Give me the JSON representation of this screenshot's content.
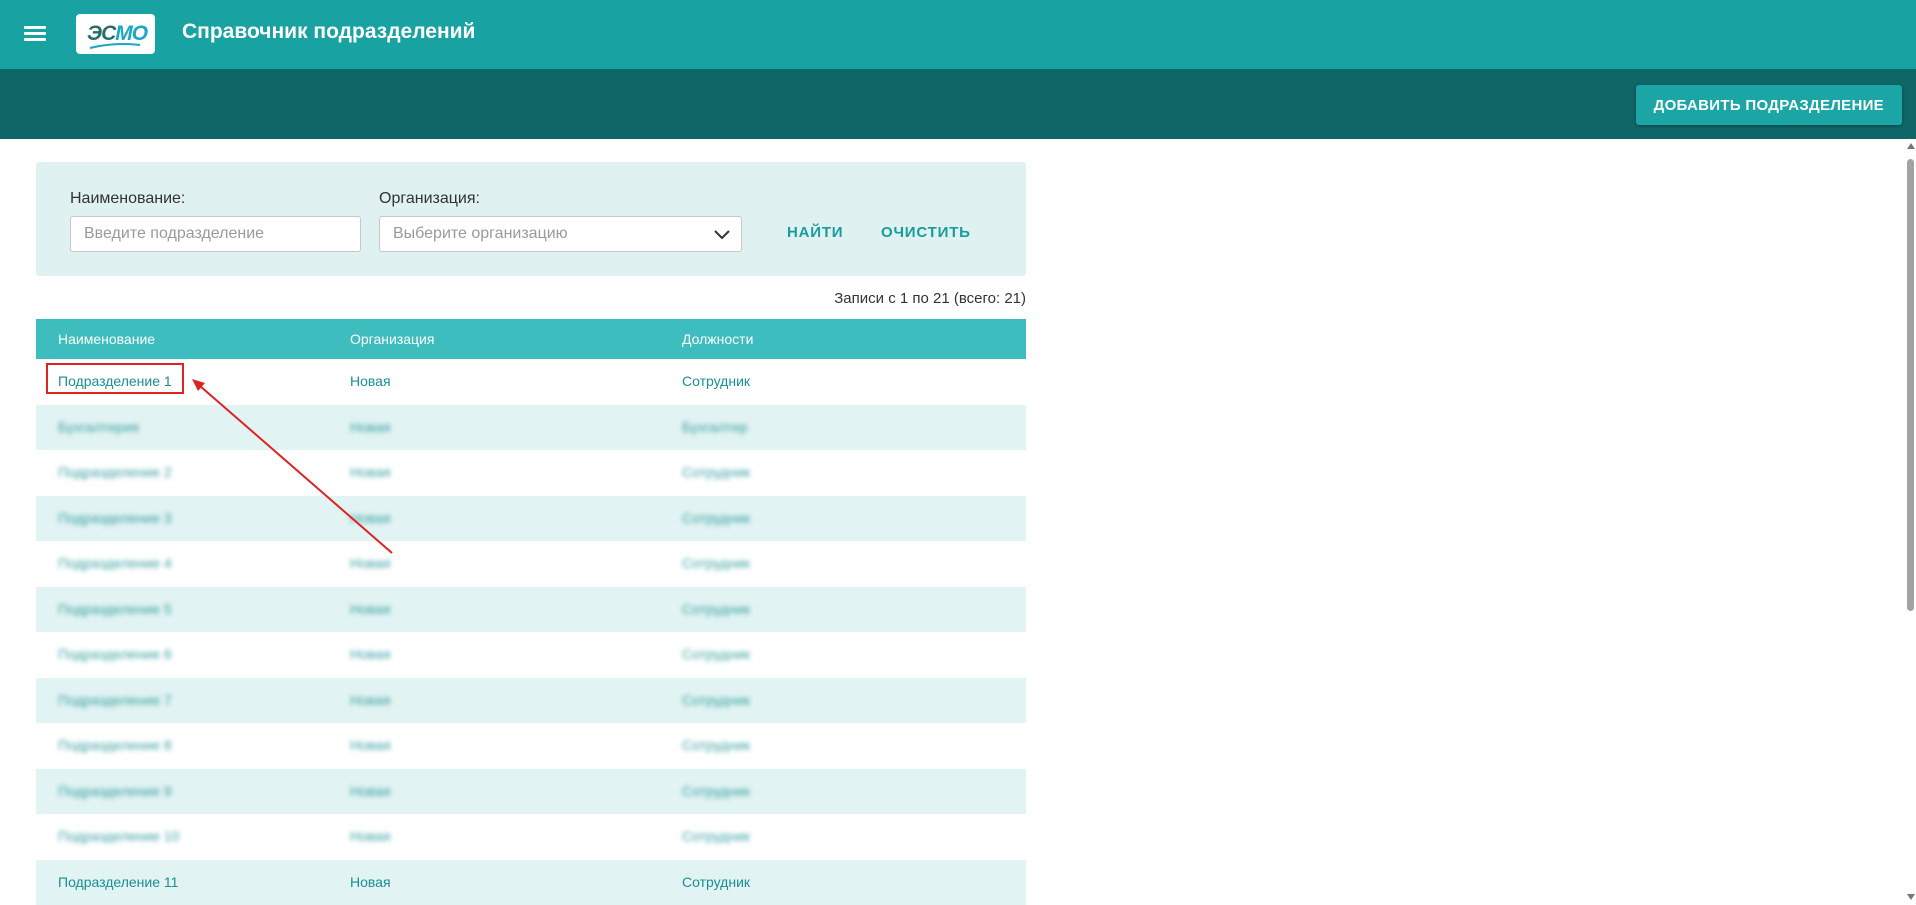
{
  "header": {
    "logo_text_main": "ЭС",
    "logo_text_accent": "МО",
    "title": "Справочник подразделений",
    "menu_icon": "hamburger-menu-icon"
  },
  "toolbar": {
    "add_label": "ДОБАВИТЬ ПОДРАЗДЕЛЕНИЕ"
  },
  "filter": {
    "name_label": "Наименование:",
    "name_placeholder": "Введите подразделение",
    "name_value": "",
    "org_label": "Организация:",
    "org_placeholder": "Выберите организацию",
    "find_label": "НАЙТИ",
    "clear_label": "ОЧИСТИТЬ"
  },
  "records_info": "Записи с 1 по 21 (всего: 21)",
  "table": {
    "columns": [
      "Наименование",
      "Организация",
      "Должности"
    ],
    "rows": [
      {
        "name": "Подразделение 1",
        "org": "Новая",
        "pos": "Сотрудник",
        "blurred": false
      },
      {
        "name": "Бухгалтерия",
        "org": "Новая",
        "pos": "Бухгалтер",
        "blurred": true
      },
      {
        "name": "Подразделение 2",
        "org": "Новая",
        "pos": "Сотрудник",
        "blurred": true
      },
      {
        "name": "Подразделение 3",
        "org": "Новая",
        "pos": "Сотрудник",
        "blurred": true
      },
      {
        "name": "Подразделение 4",
        "org": "Новая",
        "pos": "Сотрудник",
        "blurred": true
      },
      {
        "name": "Подразделение 5",
        "org": "Новая",
        "pos": "Сотрудник",
        "blurred": true
      },
      {
        "name": "Подразделение 6",
        "org": "Новая",
        "pos": "Сотрудник",
        "blurred": true
      },
      {
        "name": "Подразделение 7",
        "org": "Новая",
        "pos": "Сотрудник",
        "blurred": true
      },
      {
        "name": "Подразделение 8",
        "org": "Новая",
        "pos": "Сотрудник",
        "blurred": true
      },
      {
        "name": "Подразделение 9",
        "org": "Новая",
        "pos": "Сотрудник",
        "blurred": true
      },
      {
        "name": "Подразделение 10",
        "org": "Новая",
        "pos": "Сотрудник",
        "blurred": true
      },
      {
        "name": "Подразделение 11",
        "org": "Новая",
        "pos": "Сотрудник",
        "blurred": false
      }
    ]
  },
  "colors": {
    "header_bg": "#18a2a2",
    "toolbar_bg": "#0f6666",
    "accent": "#1ba5a5",
    "table_header_bg": "#3dbdbd",
    "link": "#1a8f94",
    "annotation": "#dd2222"
  }
}
